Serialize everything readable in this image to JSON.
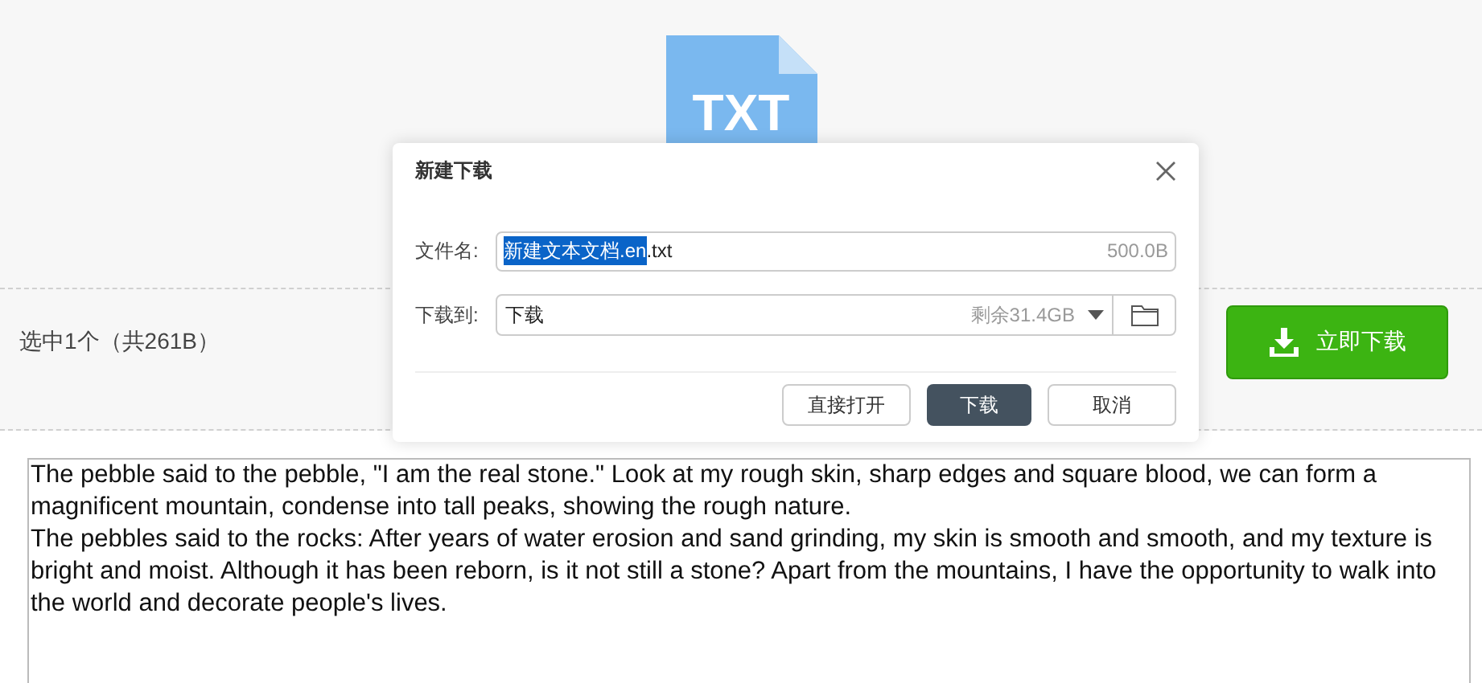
{
  "file_preview": {
    "icon_text": "TXT"
  },
  "selection_summary": "选中1个（共261B）",
  "download_now_button": "立即下载",
  "content": [
    "The pebble said to the pebble, \"I am the real stone.\" Look at my rough skin, sharp edges and square blood, we can form a magnificent mountain, condense into tall peaks, showing the rough nature.",
    "The pebbles said to the rocks: After years of water erosion and sand grinding, my skin is smooth and smooth, and my texture is bright and moist. Although it has been reborn, is it not still a stone? Apart from the mountains, I have the opportunity to walk into the world and decorate people's lives."
  ],
  "dialog": {
    "title": "新建下载",
    "filename": {
      "label": "文件名:",
      "selected_text": "新建文本文档.en",
      "rest_text": ".txt",
      "size": "500.0B"
    },
    "destination": {
      "label": "下载到:",
      "value": "下载",
      "free_space": "剩余31.4GB"
    },
    "buttons": [
      {
        "label": "直接打开",
        "kind": "secondary"
      },
      {
        "label": "下载",
        "kind": "primary"
      },
      {
        "label": "取消",
        "kind": "secondary"
      }
    ]
  }
}
